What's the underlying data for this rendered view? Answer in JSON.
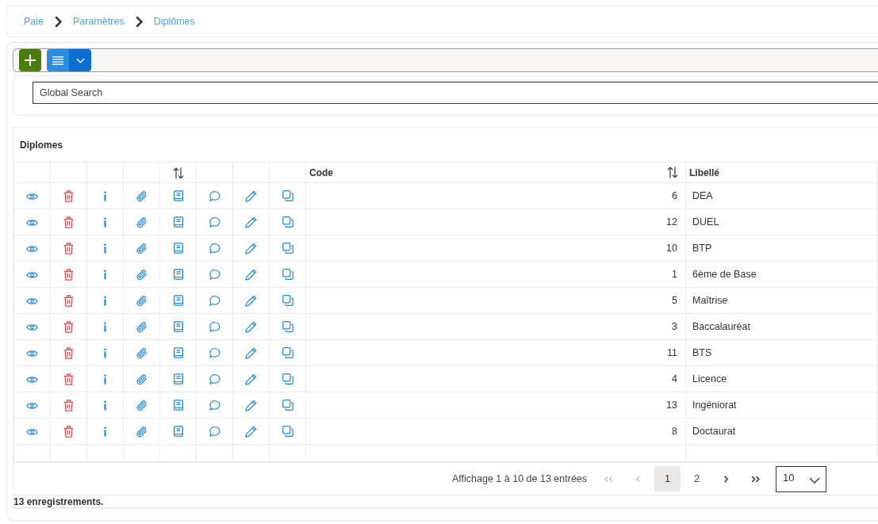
{
  "breadcrumb": [
    {
      "label": "Paie"
    },
    {
      "label": "Paramètres"
    },
    {
      "label": "Diplômes"
    }
  ],
  "search": {
    "placeholder": "Global Search"
  },
  "table": {
    "title": "Diplomes",
    "action_columns": [
      {
        "kind": "view",
        "sortable": false
      },
      {
        "kind": "delete",
        "sortable": false
      },
      {
        "kind": "info",
        "sortable": false
      },
      {
        "kind": "attach",
        "sortable": false
      },
      {
        "kind": "document",
        "sortable": true
      },
      {
        "kind": "comment",
        "sortable": false
      },
      {
        "kind": "edit",
        "sortable": false
      },
      {
        "kind": "duplicate",
        "sortable": false
      }
    ],
    "columns": [
      {
        "label": "Code",
        "sortable": true
      },
      {
        "label": "Libellé"
      }
    ],
    "rows": [
      {
        "code": "6",
        "label": "DEA"
      },
      {
        "code": "12",
        "label": "DUEL"
      },
      {
        "code": "10",
        "label": "BTP"
      },
      {
        "code": "1",
        "label": "6ème de Base"
      },
      {
        "code": "5",
        "label": "Maîtrise"
      },
      {
        "code": "3",
        "label": "Baccalauréat"
      },
      {
        "code": "11",
        "label": "BTS"
      },
      {
        "code": "4",
        "label": "Licence"
      },
      {
        "code": "13",
        "label": "Ingéniorat"
      },
      {
        "code": "8",
        "label": "Doctaurat"
      }
    ],
    "pagination": {
      "summary": "Affichage 1 à 10 de 13 entrées",
      "nav": [
        {
          "kind": "first",
          "disabled": true
        },
        {
          "kind": "previous",
          "disabled": true
        },
        {
          "kind": "next",
          "disabled": false
        },
        {
          "kind": "last",
          "disabled": false
        }
      ],
      "pages": [
        {
          "label": "1",
          "selected": true
        },
        {
          "label": "2",
          "selected": false
        }
      ],
      "page_size": "10"
    },
    "footer": "13 enregistrements."
  }
}
